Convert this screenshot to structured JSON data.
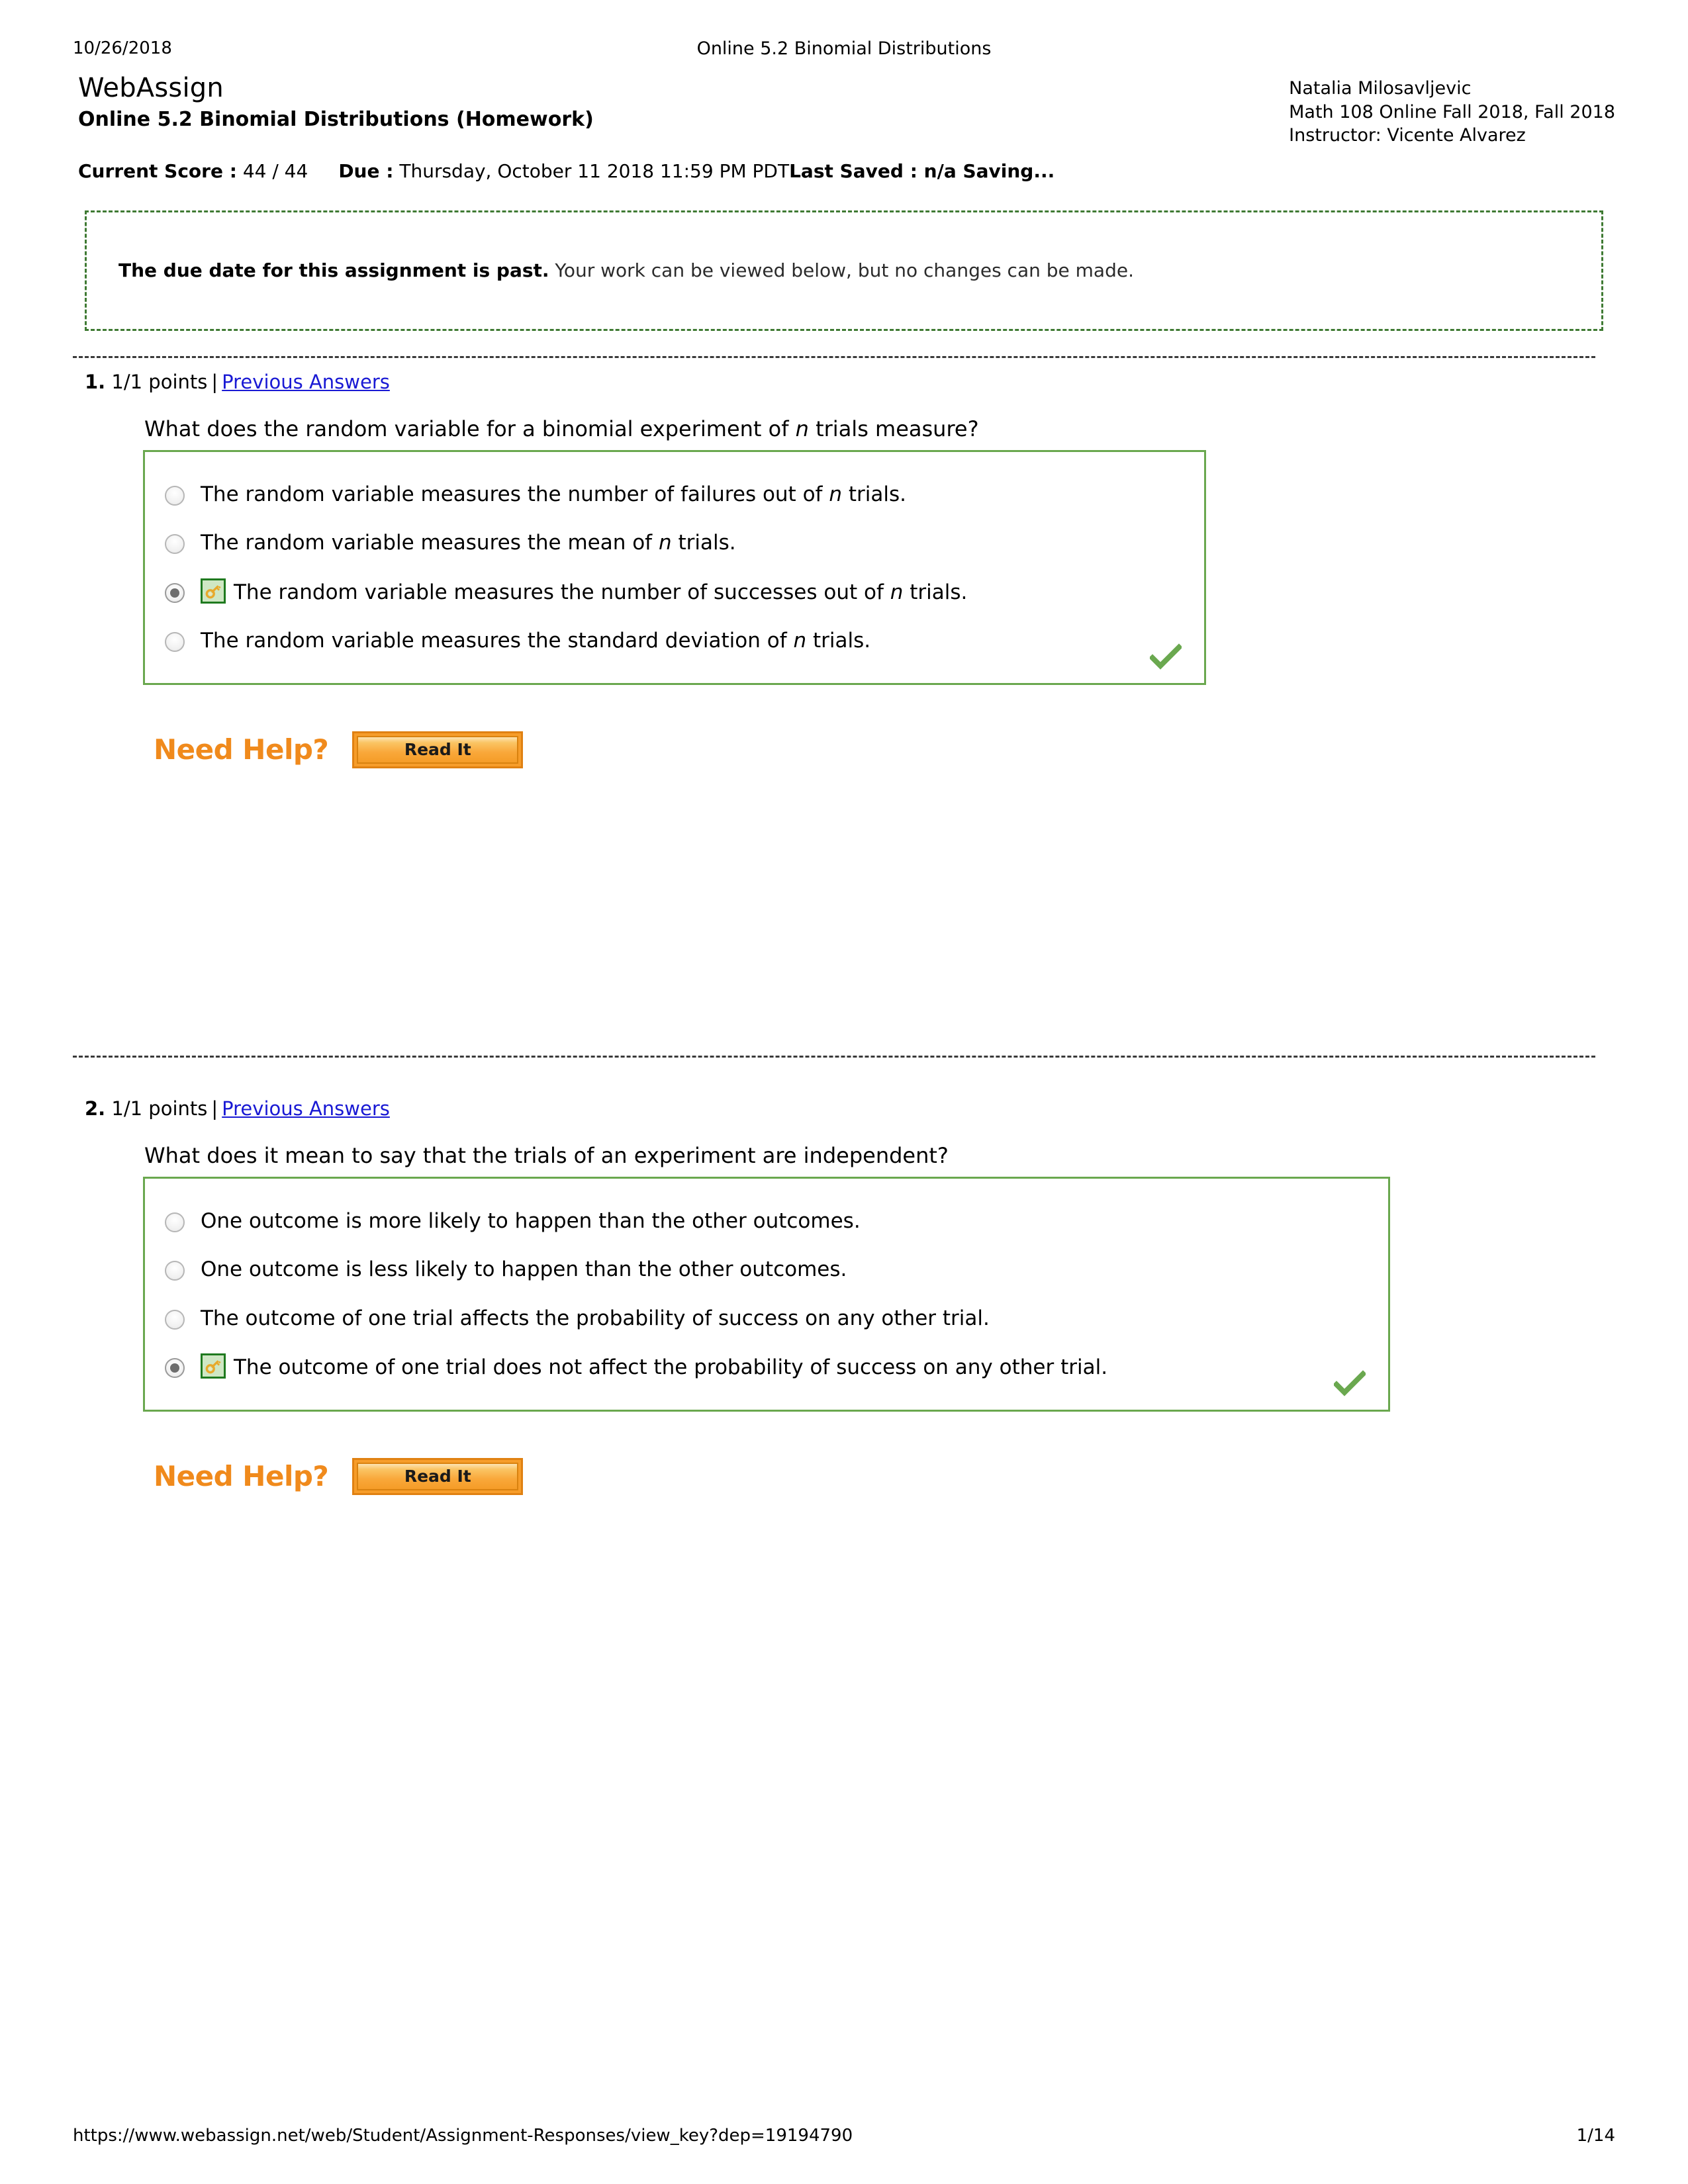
{
  "print_header": {
    "date": "10/26/2018",
    "title": "Online 5.2 Binomial Distributions"
  },
  "masthead": {
    "brand": "WebAssign",
    "assignment_title": "Online 5.2 Binomial Distributions (Homework)",
    "student_name": "Natalia Milosavljevic",
    "course": "Math 108 Online Fall 2018, Fall 2018",
    "instructor": "Instructor: Vicente Alvarez"
  },
  "score_line": {
    "current_score_label": "Current Score :",
    "current_score_value": "44 / 44",
    "due_label": "Due :",
    "due_value": "Thursday, October 11 2018 11:59 PM PDT",
    "last_saved_label": "Last Saved : n/a Saving..."
  },
  "notice": {
    "bold": "The due date for this assignment is past.",
    "rest": " Your work can be viewed below, but no changes can be made."
  },
  "questions": [
    {
      "number": "1.",
      "points": "1/1 points",
      "separator": "|",
      "previous_answers": "Previous Answers",
      "prompt_pre": "What does the random variable for a binomial experiment of ",
      "prompt_var": "n",
      "prompt_post": " trials measure?",
      "options": [
        {
          "selected": false,
          "has_key": false,
          "pre": "The random variable measures the number of failures out of ",
          "var": "n",
          "post": " trials."
        },
        {
          "selected": false,
          "has_key": false,
          "pre": "The random variable measures the mean of ",
          "var": "n",
          "post": " trials."
        },
        {
          "selected": true,
          "has_key": true,
          "pre": "The random variable measures the number of successes out of ",
          "var": "n",
          "post": " trials."
        },
        {
          "selected": false,
          "has_key": false,
          "pre": "The random variable measures the standard deviation of ",
          "var": "n",
          "post": " trials."
        }
      ],
      "need_help_label": "Need Help?",
      "read_it_label": "Read It"
    },
    {
      "number": "2.",
      "points": "1/1 points",
      "separator": "|",
      "previous_answers": "Previous Answers",
      "prompt_pre": "What does it mean to say that the trials of an experiment are independent?",
      "prompt_var": "",
      "prompt_post": "",
      "options": [
        {
          "selected": false,
          "has_key": false,
          "pre": "One outcome is more likely to happen than the other outcomes.",
          "var": "",
          "post": ""
        },
        {
          "selected": false,
          "has_key": false,
          "pre": "One outcome is less likely to happen than the other outcomes.",
          "var": "",
          "post": ""
        },
        {
          "selected": false,
          "has_key": false,
          "pre": "The outcome of one trial affects the probability of success on any other trial.",
          "var": "",
          "post": ""
        },
        {
          "selected": true,
          "has_key": true,
          "pre": "The outcome of one trial does not affect the probability of success on any other trial.",
          "var": "",
          "post": ""
        }
      ],
      "need_help_label": "Need Help?",
      "read_it_label": "Read It"
    }
  ],
  "footer": {
    "url": "https://www.webassign.net/web/Student/Assignment-Responses/view_key?dep=19194790",
    "page": "1/14"
  },
  "icons": {
    "key": "key-icon",
    "check": "green-check-icon"
  },
  "colors": {
    "link": "#1919d4",
    "answer_box_border": "#6aa84f",
    "notice_border": "#3f7a33",
    "need_help_orange": "#f08a1c",
    "button_orange": "#f79d2a",
    "key_bg": "#cfe7c4",
    "key_border": "#1f7a1f",
    "check_green": "#6aa84f"
  }
}
